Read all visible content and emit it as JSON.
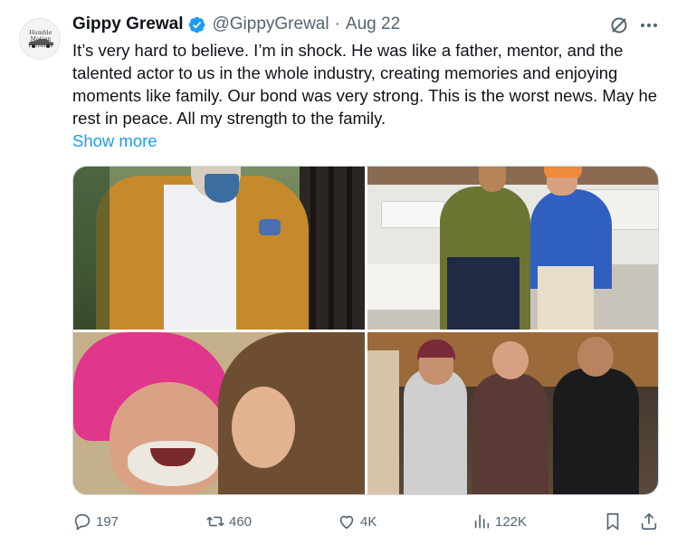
{
  "author": {
    "name": "Gippy Grewal",
    "handle": "@GippyGrewal",
    "separator": "·",
    "date": "Aug 22",
    "avatar_text": "Humble Motion Pictures"
  },
  "tweet": {
    "text": "It’s very hard to believe. I’m in shock. He was like a father, mentor, and the talented actor to us in the whole industry, creating memories and enjoying moments like family. Our bond was very strong. This is the worst news. May he rest in peace. All my strength to the family.",
    "show_more": "Show more"
  },
  "media": {
    "count": 4,
    "photos": [
      "photo-1",
      "photo-2",
      "photo-3",
      "photo-4"
    ]
  },
  "actions": {
    "replies": "197",
    "reposts": "460",
    "likes": "4K",
    "views": "122K"
  },
  "icons": {
    "verified": "verified-badge-icon",
    "grok": "grok-icon",
    "more": "more-icon",
    "reply": "reply-icon",
    "repost": "repost-icon",
    "like": "heart-icon",
    "views": "views-icon",
    "bookmark": "bookmark-icon",
    "share": "share-icon"
  },
  "colors": {
    "accent": "#1d9bf0",
    "text": "#0f1419",
    "secondary": "#536471",
    "border": "#cfd9de"
  }
}
